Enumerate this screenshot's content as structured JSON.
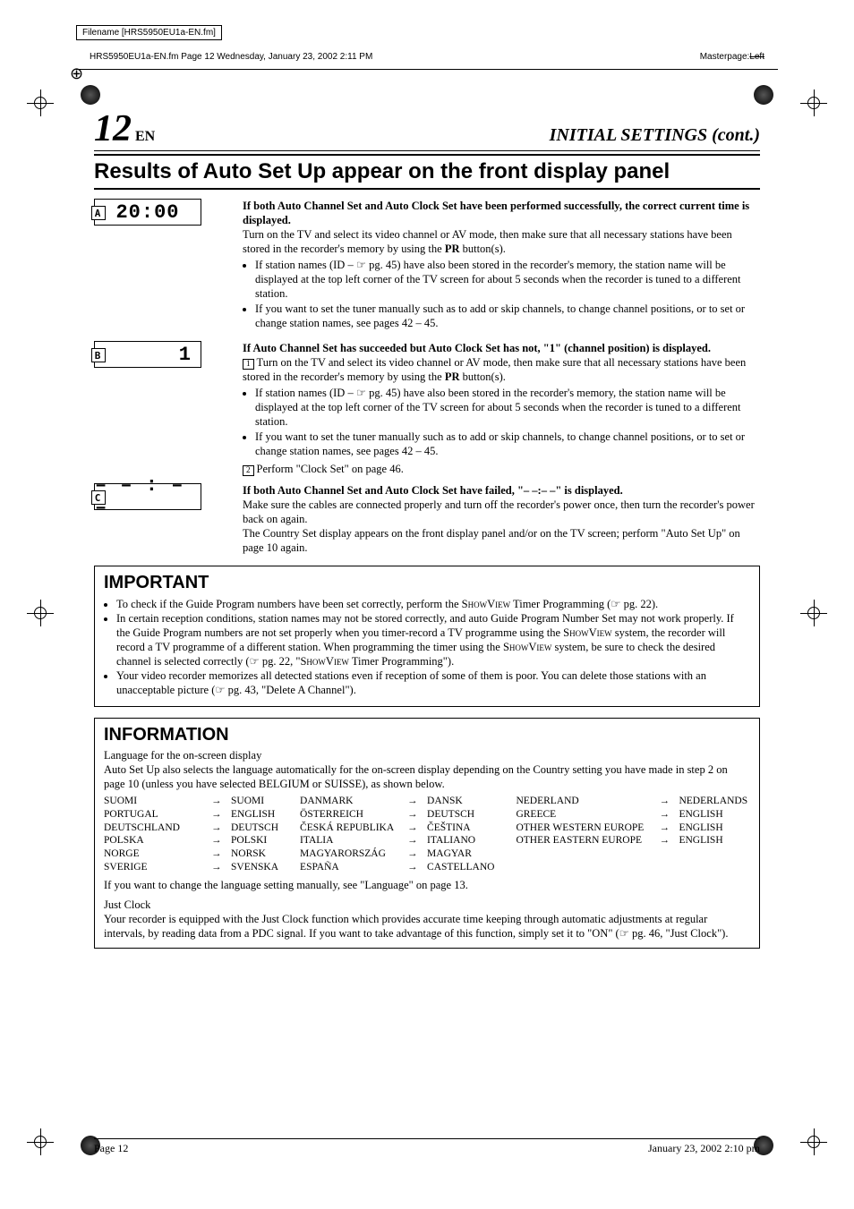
{
  "meta": {
    "filename_label": "Filename [HRS5950EU1a-EN.fm]",
    "fm_line": "HRS5950EU1a-EN.fm  Page 12  Wednesday, January 23, 2002  2:11 PM",
    "masterpage_label": "Masterpage:",
    "masterpage_value": "Left"
  },
  "header": {
    "page_number": "12",
    "page_lang": "EN",
    "section_title": "INITIAL SETTINGS (cont.)",
    "main_heading": "Results of Auto Set Up appear on the front display panel"
  },
  "displays": {
    "a_label": "A",
    "a_value": "20:00",
    "b_label": "B",
    "b_value": "1",
    "c_label": "C",
    "c_value": "– – : – –"
  },
  "scenarioA": {
    "title": "If both Auto Channel Set and Auto Clock Set have been performed successfully, the correct current time is displayed.",
    "para": "Turn on the TV and select its video channel or AV mode, then make sure that all necessary stations have been stored in the recorder's memory by using the ",
    "pr": "PR",
    "para_end": " button(s).",
    "bullet1": "If station names (ID – ☞ pg. 45) have also been stored in the recorder's memory, the station name will be displayed at the top left corner of the TV screen for about 5 seconds when the recorder is tuned to a different station.",
    "bullet2": "If you want to set the tuner manually such as to add or skip channels, to change channel positions, or to set or change station names, see pages 42 – 45."
  },
  "scenarioB": {
    "title": "If Auto Channel Set has succeeded but Auto Clock Set has not, \"1\" (channel position) is displayed.",
    "step1_num": "1",
    "step1": "Turn on the TV and select its video channel or AV mode, then make sure that all necessary stations have been stored in the recorder's memory by using the ",
    "pr": "PR",
    "step1_end": " button(s).",
    "bullet1": "If station names (ID – ☞ pg. 45) have also been stored in the recorder's memory, the station name will be displayed at the top left corner of the TV screen for about 5 seconds when the recorder is tuned to a different station.",
    "bullet2": "If you want to set the tuner manually such as to add or skip channels, to change channel positions, or to set or change station names, see pages 42 – 45.",
    "step2_num": "2",
    "step2": "Perform \"Clock Set\" on page 46."
  },
  "scenarioC": {
    "title": "If both Auto Channel Set and Auto Clock Set have failed, \"– –:– –\" is displayed.",
    "para1": "Make sure the cables are connected properly and turn off the recorder's power once, then turn the recorder's power back on again.",
    "para2": "The Country Set display appears on the front display panel and/or on the TV screen; perform \"Auto Set Up\" on page 10 again."
  },
  "important": {
    "title": "IMPORTANT",
    "b1a": "To check if the Guide Program numbers have been set correctly, perform the ",
    "b1sv": "ShowView",
    "b1b": " Timer Programming (☞ pg. 22).",
    "b2a": "In certain reception conditions, station names may not be stored correctly, and auto Guide Program Number Set may not work properly. If the Guide Program numbers are not set properly when you timer-record a TV programme using the ",
    "b2b": " system, the recorder will record a TV programme of a different station. When programming the timer using the ",
    "b2c": " system, be sure to check the desired channel is selected correctly (☞ pg. 22, \"",
    "b2d": " Timer Programming\").",
    "b3": "Your video recorder memorizes all detected stations even if reception of some of them is poor. You can delete those stations with an unacceptable picture (☞ pg. 43, \"Delete A Channel\")."
  },
  "information": {
    "title": "INFORMATION",
    "lang_heading": "Language for the on-screen display",
    "lang_intro_a": "Auto Set Up also selects the language automatically for the on-screen display depending on the Country setting you have made in step ",
    "lang_step": "2",
    "lang_intro_b": " on page 10 (unless you have selected BELGIUM or SUISSE), as shown below.",
    "languages": [
      [
        {
          "src": "SUOMI",
          "dst": "SUOMI"
        },
        {
          "src": "PORTUGAL",
          "dst": "ENGLISH"
        },
        {
          "src": "DEUTSCHLAND",
          "dst": "DEUTSCH"
        },
        {
          "src": "POLSKA",
          "dst": "POLSKI"
        },
        {
          "src": "NORGE",
          "dst": "NORSK"
        },
        {
          "src": "SVERIGE",
          "dst": "SVENSKA"
        }
      ],
      [
        {
          "src": "DANMARK",
          "dst": "DANSK"
        },
        {
          "src": "ÖSTERREICH",
          "dst": "DEUTSCH"
        },
        {
          "src": "ČESKÁ REPUBLIKA",
          "dst": "ČEŠTINA"
        },
        {
          "src": "ITALIA",
          "dst": "ITALIANO"
        },
        {
          "src": "MAGYARORSZÁG",
          "dst": "MAGYAR"
        },
        {
          "src": "ESPAÑA",
          "dst": "CASTELLANO"
        }
      ],
      [
        {
          "src": "NEDERLAND",
          "dst": "NEDERLANDS"
        },
        {
          "src": "GREECE",
          "dst": "ENGLISH"
        },
        {
          "src": "OTHER WESTERN EUROPE",
          "dst": "ENGLISH"
        },
        {
          "src": "OTHER EASTERN EUROPE",
          "dst": "ENGLISH"
        }
      ]
    ],
    "lang_outro": "If you want to change the language setting manually, see \"Language\" on page 13.",
    "just_clock_heading": "Just Clock",
    "just_clock_text": "Your recorder is equipped with the Just Clock function which provides accurate time keeping through automatic adjustments at regular intervals, by reading data from a PDC signal. If you want to take advantage of this function, simply set it to \"ON\" (☞ pg. 46, \"Just Clock\")."
  },
  "footer": {
    "page": "Page 12",
    "date": "January 23, 2002 2:10 pm"
  }
}
